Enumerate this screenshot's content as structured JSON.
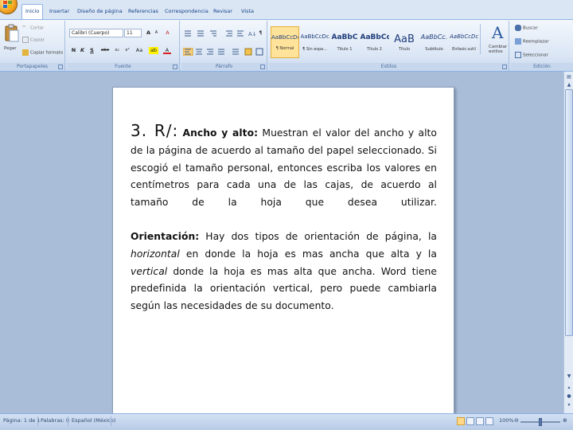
{
  "window": {
    "office_button": "office-button"
  },
  "tabs": [
    "Inicio",
    "Insertar",
    "Diseño de página",
    "Referencias",
    "Correspondencia",
    "Revisar",
    "Vista"
  ],
  "ribbon": {
    "clipboard": {
      "paste_label": "Pegar",
      "cut_label": "Cortar",
      "copy_label": "Copiar",
      "format_painter_label": "Copiar formato",
      "group_label": "Portapapeles"
    },
    "font": {
      "font_name": "Calibri (Cuerpo)",
      "font_size": "11",
      "bold": "N",
      "italic": "K",
      "underline": "S",
      "strike": "abe",
      "subscript": "x₂",
      "superscript": "x²",
      "case": "Aa",
      "grow": "A",
      "shrink": "A",
      "clear": "A",
      "highlight": "ab",
      "color": "A",
      "group_label": "Fuente"
    },
    "paragraph": {
      "group_label": "Párrafo",
      "pilcrow": "¶"
    },
    "styles": {
      "items": [
        {
          "sample": "AaBbCcDc",
          "name": "¶ Normal"
        },
        {
          "sample": "AaBbCcDc",
          "name": "¶ Sin espa..."
        },
        {
          "sample": "AaBbC",
          "name": "Título 1"
        },
        {
          "sample": "AaBbCc",
          "name": "Título 2"
        },
        {
          "sample": "AaB",
          "name": "Título"
        },
        {
          "sample": "AaBbCc.",
          "name": "Subtítulo"
        },
        {
          "sample": "AaBbCcDc",
          "name": "Énfasis sutil"
        }
      ],
      "change_styles_label": "Cambiar estilos",
      "group_label": "Estilos"
    },
    "editing": {
      "find_label": "Buscar",
      "replace_label": "Reemplazar",
      "select_label": "Seleccionar",
      "group_label": "Edición"
    }
  },
  "document": {
    "heading_prefix": "3.  R/:",
    "p1_label": "Ancho y alto:",
    "p1_text": " Muestran el valor del ancho y alto de la página de acuerdo al tamaño del papel seleccionado. Si escogió el tamaño personal, entonces escriba los valores en centímetros para cada una de las cajas, de acuerdo al tamaño de la hoja que desea utilizar.",
    "p2_label": "Orientación:",
    "p2_text_a": " Hay dos tipos de orientación de página, la ",
    "p2_italic_a": "horizontal",
    "p2_text_b": " en donde la hoja es mas ancha que alta y la ",
    "p2_italic_b": "vertical",
    "p2_text_c": " donde la hoja es mas alta que ancha. Word tiene predefinida la orientación vertical, pero puede cambiarla según las necesidades de su documento."
  },
  "statusbar": {
    "page": "Página: 1 de 1",
    "words": "Palabras: 0",
    "language": "Español (México)",
    "zoom": "100%"
  }
}
